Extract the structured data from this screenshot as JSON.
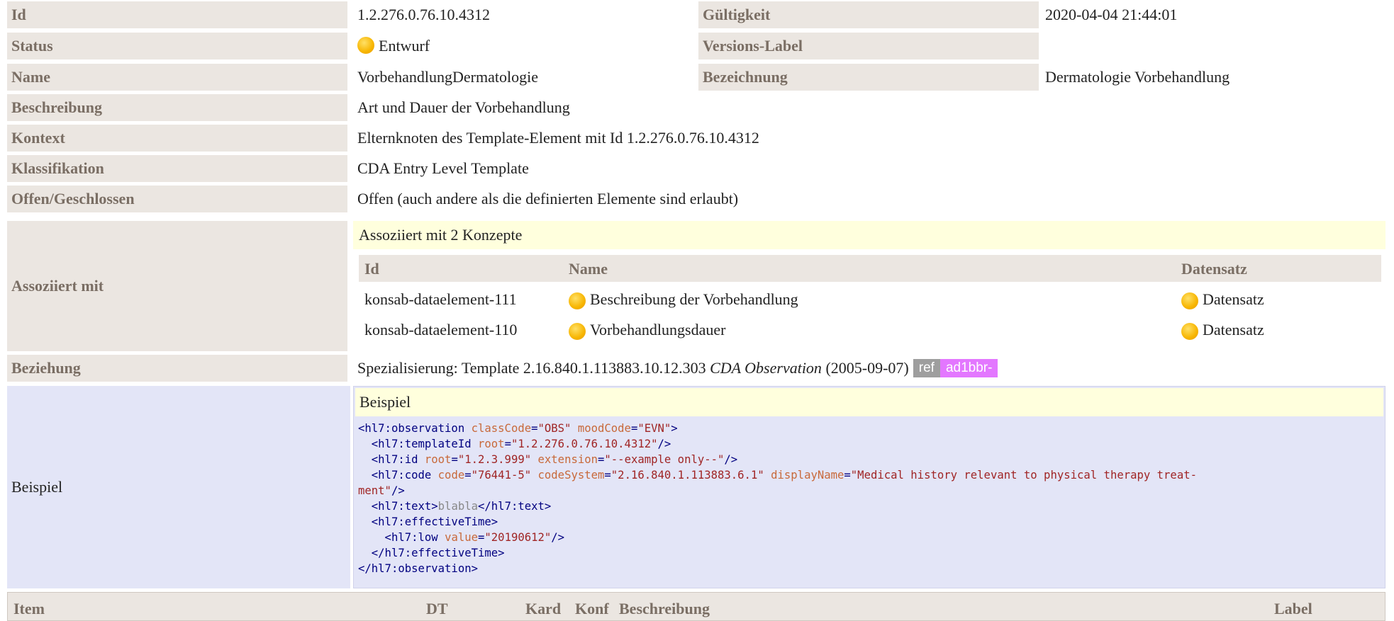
{
  "header": {
    "id_label": "Id",
    "id_value": "1.2.276.0.76.10.4312",
    "validity_label": "Gültigkeit",
    "validity_value": "2020-04-04 21:44:01",
    "status_label": "Status",
    "status_value": "Entwurf",
    "version_label": "Versions-Label",
    "name_label": "Name",
    "name_value": "VorbehandlungDermatologie",
    "designation_label": "Bezeichnung",
    "designation_value": "Dermatologie Vorbehandlung",
    "description_label": "Beschreibung",
    "description_value": "Art und Dauer der Vorbehandlung",
    "context_label": "Kontext",
    "context_value": "Elternknoten des Template-Element mit Id 1.2.276.0.76.10.4312",
    "classification_label": "Klassifikation",
    "classification_value": "CDA Entry Level Template",
    "open_label": "Offen/Geschlossen",
    "open_value": "Offen (auch andere als die definierten Elemente sind erlaubt)",
    "associated_label": "Assoziiert mit",
    "relation_label": "Beziehung",
    "relation_prefix": "Spezialisierung: Template 2.16.840.1.113883.10.12.303",
    "relation_italic": "CDA Observation",
    "relation_date": "(2005-09-07)",
    "relation_ref": "ref",
    "relation_id": "ad1bbr-",
    "example_label": "Beispiel"
  },
  "associated": {
    "title": "Assoziiert mit 2 Konzepte",
    "columns": [
      "Id",
      "Name",
      "Datensatz"
    ],
    "rows": [
      {
        "id": "konsab-dataelement-111",
        "name": "Beschreibung der Vorbehandlung",
        "dataset": "Datensatz"
      },
      {
        "id": "konsab-dataelement-110",
        "name": "Vorbehandlungsdauer",
        "dataset": "Datensatz"
      }
    ]
  },
  "example": {
    "title": "Beispiel"
  },
  "table": {
    "columns": [
      "Item",
      "DT",
      "Kard",
      "Konf",
      "Beschreibung",
      "Label"
    ]
  },
  "colors": {
    "label_bg": "#ebe6e1",
    "label_text": "#7a6e64",
    "highlight_bg": "#ffffdd",
    "example_bg": "#e3e5f7",
    "status_dot": "#f7b500",
    "ref_tag": "#9e9e9e",
    "id_tag": "#e377ff"
  }
}
